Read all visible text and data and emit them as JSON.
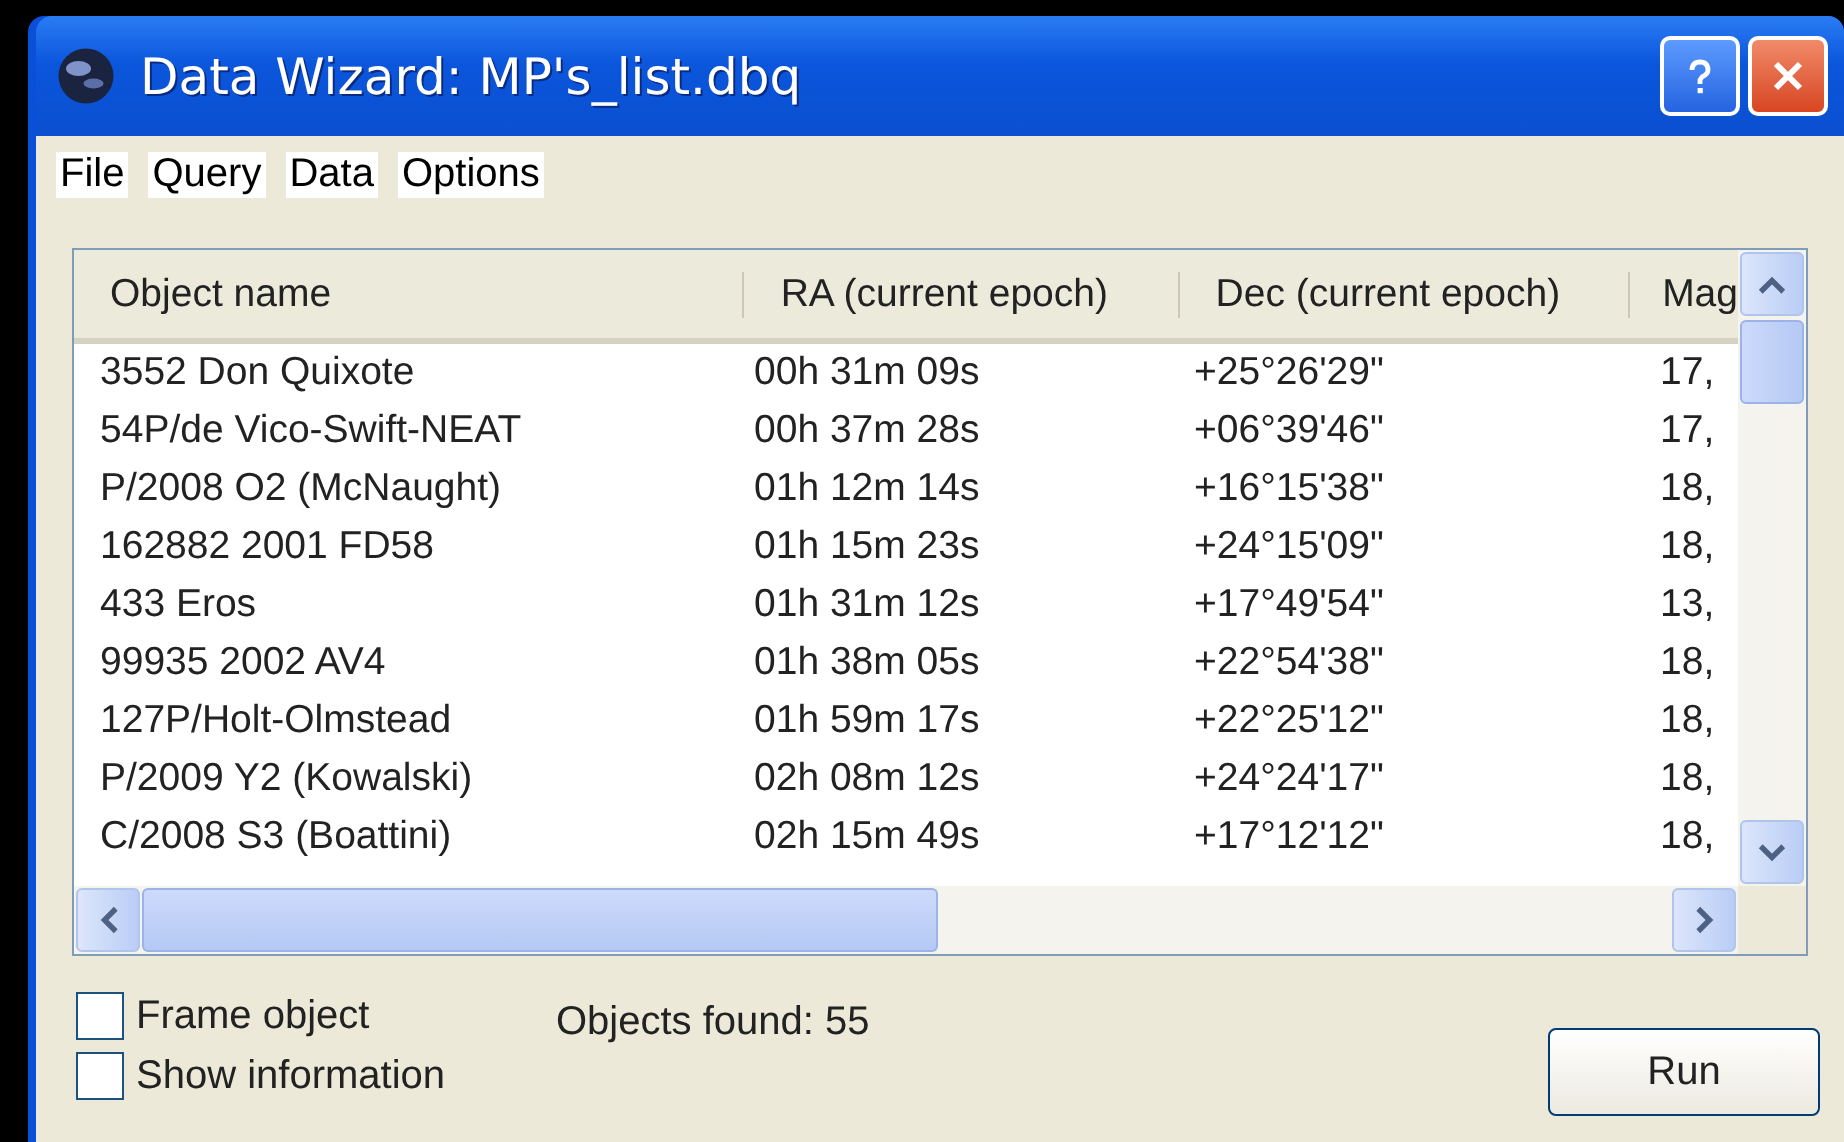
{
  "window": {
    "title": "Data Wizard: MP's_list.dbq"
  },
  "menu": [
    "File",
    "Query",
    "Data",
    "Options"
  ],
  "table": {
    "columns": [
      "Object name",
      "RA (current epoch)",
      "Dec (current epoch)",
      "Mag"
    ],
    "rows": [
      [
        "3552 Don Quixote",
        "00h 31m 09s",
        "+25°26'29\"",
        "17,"
      ],
      [
        "54P/de Vico-Swift-NEAT",
        "00h 37m 28s",
        "+06°39'46\"",
        "17,"
      ],
      [
        "P/2008 O2 (McNaught)",
        "01h 12m 14s",
        "+16°15'38\"",
        "18,"
      ],
      [
        "162882 2001 FD58",
        "01h 15m 23s",
        "+24°15'09\"",
        "18,"
      ],
      [
        "433 Eros",
        "01h 31m 12s",
        "+17°49'54\"",
        "13,"
      ],
      [
        "99935 2002 AV4",
        "01h 38m 05s",
        "+22°54'38\"",
        "18,"
      ],
      [
        "127P/Holt-Olmstead",
        "01h 59m 17s",
        "+22°25'12\"",
        "18,"
      ],
      [
        "P/2009 Y2 (Kowalski)",
        "02h 08m 12s",
        "+24°24'17\"",
        "18,"
      ],
      [
        "C/2008 S3 (Boattini)",
        "02h 15m 49s",
        "+17°12'12\"",
        "18,"
      ]
    ]
  },
  "options": [
    {
      "label": "Frame object",
      "checked": false
    },
    {
      "label": "Show information",
      "checked": false
    }
  ],
  "status": "Objects found: 55",
  "run_button": "Run"
}
